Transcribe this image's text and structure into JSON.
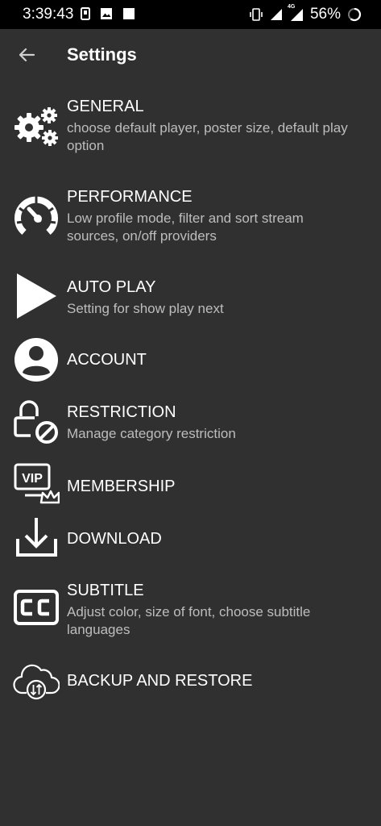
{
  "status_bar": {
    "time": "3:39:43",
    "battery_percent": "56%",
    "network_badge": "4G"
  },
  "header": {
    "title": "Settings"
  },
  "items": [
    {
      "title": "GENERAL",
      "subtitle": "choose default player, poster size, default play option",
      "icon": "gears-icon"
    },
    {
      "title": "PERFORMANCE",
      "subtitle": "Low profile mode, filter and sort stream sources, on/off providers",
      "icon": "speedometer-icon"
    },
    {
      "title": "AUTO PLAY",
      "subtitle": "Setting for show play next",
      "icon": "play-icon"
    },
    {
      "title": "ACCOUNT",
      "subtitle": "",
      "icon": "account-icon"
    },
    {
      "title": "RESTRICTION",
      "subtitle": "Manage category restriction",
      "icon": "lock-block-icon"
    },
    {
      "title": "MEMBERSHIP",
      "subtitle": "",
      "icon": "vip-crown-icon"
    },
    {
      "title": "DOWNLOAD",
      "subtitle": "",
      "icon": "download-icon"
    },
    {
      "title": "SUBTITLE",
      "subtitle": "Adjust color, size of font, choose subtitle languages",
      "icon": "cc-icon"
    },
    {
      "title": "BACKUP AND RESTORE",
      "subtitle": "",
      "icon": "cloud-sync-icon"
    }
  ]
}
